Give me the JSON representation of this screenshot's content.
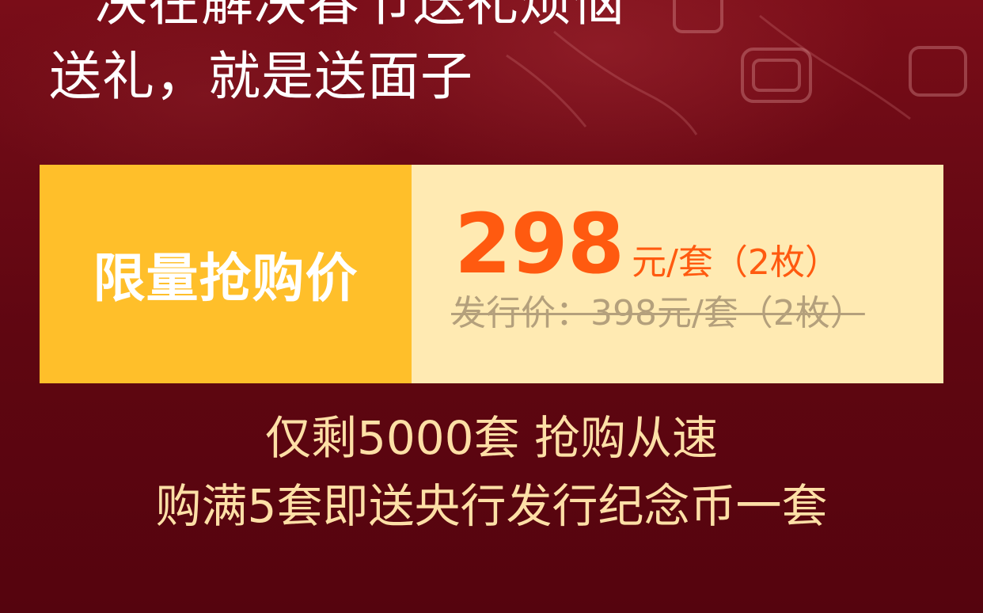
{
  "headline": {
    "line1": "决在解决春节送礼烦恼",
    "line2": "送礼，就是送面子"
  },
  "price_box": {
    "label": "限量抢购价",
    "price": "298",
    "unit": "元/套（2枚）",
    "original": "发行价：398元/套（2枚）"
  },
  "promo": {
    "line1": "仅剩5000套  抢购从速",
    "line2": "购满5套即送央行发行纪念币一套"
  },
  "colors": {
    "background": "#5e0610",
    "label_bg": "#ffbf2a",
    "price_bg": "#ffeab2",
    "price_text": "#ff5a10",
    "promo_text": "#fddfa6"
  }
}
